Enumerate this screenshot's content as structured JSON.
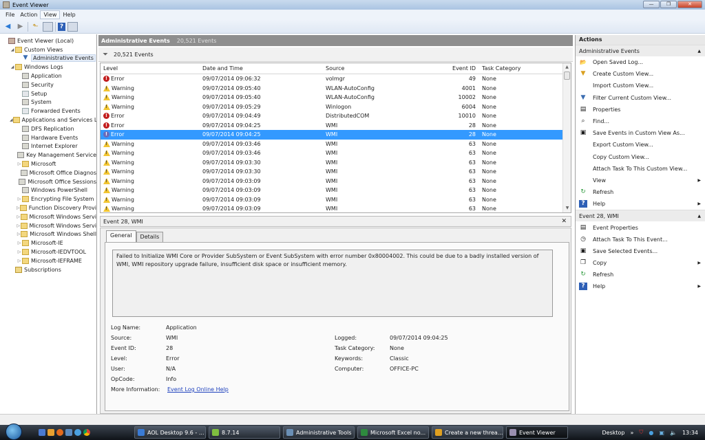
{
  "window": {
    "title": "Event Viewer",
    "controls": [
      "minimize",
      "maximize",
      "close"
    ]
  },
  "menu": [
    "File",
    "Action",
    "View",
    "Help"
  ],
  "menu_active": "View",
  "tree": [
    {
      "label": "Event Viewer (Local)",
      "level": 0,
      "icon": "root",
      "arrow": ""
    },
    {
      "label": "Custom Views",
      "level": 1,
      "icon": "folder",
      "arrow": "◢"
    },
    {
      "label": "Administrative Events",
      "level": 2,
      "icon": "filter",
      "arrow": "",
      "selected": true
    },
    {
      "label": "Windows Logs",
      "level": 1,
      "icon": "folder",
      "arrow": "◢"
    },
    {
      "label": "Application",
      "level": 2,
      "icon": "log",
      "arrow": ""
    },
    {
      "label": "Security",
      "level": 2,
      "icon": "log",
      "arrow": ""
    },
    {
      "label": "Setup",
      "level": 2,
      "icon": "logg",
      "arrow": ""
    },
    {
      "label": "System",
      "level": 2,
      "icon": "log",
      "arrow": ""
    },
    {
      "label": "Forwarded Events",
      "level": 2,
      "icon": "logg",
      "arrow": ""
    },
    {
      "label": "Applications and Services Lo",
      "level": 1,
      "icon": "folder",
      "arrow": "◢"
    },
    {
      "label": "DFS Replication",
      "level": 2,
      "icon": "log",
      "arrow": ""
    },
    {
      "label": "Hardware Events",
      "level": 2,
      "icon": "log",
      "arrow": ""
    },
    {
      "label": "Internet Explorer",
      "level": 2,
      "icon": "log",
      "arrow": ""
    },
    {
      "label": "Key Management Service",
      "level": 2,
      "icon": "log",
      "arrow": ""
    },
    {
      "label": "Microsoft",
      "level": 2,
      "icon": "folder",
      "arrow": "▷"
    },
    {
      "label": "Microsoft Office Diagnos",
      "level": 2,
      "icon": "log",
      "arrow": ""
    },
    {
      "label": "Microsoft Office Sessions",
      "level": 2,
      "icon": "log",
      "arrow": ""
    },
    {
      "label": "Windows PowerShell",
      "level": 2,
      "icon": "log",
      "arrow": ""
    },
    {
      "label": "Encrypting File System",
      "level": 2,
      "icon": "folder",
      "arrow": "▷"
    },
    {
      "label": "Function Discovery Provi",
      "level": 2,
      "icon": "folder",
      "arrow": "▷"
    },
    {
      "label": "Microsoft Windows Servi",
      "level": 2,
      "icon": "folder",
      "arrow": "▷"
    },
    {
      "label": "Microsoft Windows Servi",
      "level": 2,
      "icon": "folder",
      "arrow": "▷"
    },
    {
      "label": "Microsoft Windows Shell",
      "level": 2,
      "icon": "folder",
      "arrow": "▷"
    },
    {
      "label": "Microsoft-IE",
      "level": 2,
      "icon": "folder",
      "arrow": "▷"
    },
    {
      "label": "Microsoft-IEDVTOOL",
      "level": 2,
      "icon": "folder",
      "arrow": "▷"
    },
    {
      "label": "Microsoft-IEFRAME",
      "level": 2,
      "icon": "folder",
      "arrow": "▷"
    },
    {
      "label": "Subscriptions",
      "level": 1,
      "icon": "sub",
      "arrow": ""
    }
  ],
  "center": {
    "title": "Administrative Events",
    "count": "20,521 Events",
    "filter_count": "20,521 Events",
    "columns": [
      "Level",
      "Date and Time",
      "Source",
      "Event ID",
      "Task Category"
    ],
    "rows": [
      {
        "level": "Error",
        "date": "09/07/2014 09:06:32",
        "source": "volmgr",
        "id": "49",
        "task": "None"
      },
      {
        "level": "Warning",
        "date": "09/07/2014 09:05:40",
        "source": "WLAN-AutoConfig",
        "id": "4001",
        "task": "None"
      },
      {
        "level": "Warning",
        "date": "09/07/2014 09:05:40",
        "source": "WLAN-AutoConfig",
        "id": "10002",
        "task": "None"
      },
      {
        "level": "Warning",
        "date": "09/07/2014 09:05:29",
        "source": "Winlogon",
        "id": "6004",
        "task": "None"
      },
      {
        "level": "Error",
        "date": "09/07/2014 09:04:49",
        "source": "DistributedCOM",
        "id": "10010",
        "task": "None"
      },
      {
        "level": "Error",
        "date": "09/07/2014 09:04:25",
        "source": "WMI",
        "id": "28",
        "task": "None"
      },
      {
        "level": "Error",
        "date": "09/07/2014 09:04:25",
        "source": "WMI",
        "id": "28",
        "task": "None",
        "selected": true
      },
      {
        "level": "Warning",
        "date": "09/07/2014 09:03:46",
        "source": "WMI",
        "id": "63",
        "task": "None"
      },
      {
        "level": "Warning",
        "date": "09/07/2014 09:03:46",
        "source": "WMI",
        "id": "63",
        "task": "None"
      },
      {
        "level": "Warning",
        "date": "09/07/2014 09:03:30",
        "source": "WMI",
        "id": "63",
        "task": "None"
      },
      {
        "level": "Warning",
        "date": "09/07/2014 09:03:30",
        "source": "WMI",
        "id": "63",
        "task": "None"
      },
      {
        "level": "Warning",
        "date": "09/07/2014 09:03:09",
        "source": "WMI",
        "id": "63",
        "task": "None"
      },
      {
        "level": "Warning",
        "date": "09/07/2014 09:03:09",
        "source": "WMI",
        "id": "63",
        "task": "None"
      },
      {
        "level": "Warning",
        "date": "09/07/2014 09:03:09",
        "source": "WMI",
        "id": "63",
        "task": "None"
      },
      {
        "level": "Warning",
        "date": "09/07/2014 09:03:09",
        "source": "WMI",
        "id": "63",
        "task": "None"
      }
    ]
  },
  "detail": {
    "title": "Event 28, WMI",
    "tabs": [
      "General",
      "Details"
    ],
    "message": "Failed to Initialize WMI Core or Provider SubSystem or Event SubSystem with error number 0x80004002. This could be due to a badly installed version of WMI, WMI repository upgrade failure, insufficient disk space or insufficient memory.",
    "left": [
      {
        "k": "Log Name:",
        "v": "Application"
      },
      {
        "k": "Source:",
        "v": "WMI"
      },
      {
        "k": "Event ID:",
        "v": "28"
      },
      {
        "k": "Level:",
        "v": "Error"
      },
      {
        "k": "User:",
        "v": "N/A"
      },
      {
        "k": "OpCode:",
        "v": "Info"
      },
      {
        "k": "More Information:",
        "v": "Event Log Online Help"
      }
    ],
    "right": [
      {
        "k": "Logged:",
        "v": "09/07/2014 09:04:25"
      },
      {
        "k": "Task Category:",
        "v": "None"
      },
      {
        "k": "Keywords:",
        "v": "Classic"
      },
      {
        "k": "Computer:",
        "v": "OFFICE-PC"
      }
    ]
  },
  "actions": {
    "title": "Actions",
    "group1": "Administrative Events",
    "items1": [
      {
        "label": "Open Saved Log...",
        "icon": "folder-open-icon",
        "glyph": "📂",
        "sub": false
      },
      {
        "label": "Create Custom View...",
        "icon": "create-filter-icon",
        "glyph": "▼",
        "sub": false
      },
      {
        "label": "Import Custom View...",
        "icon": "",
        "glyph": "",
        "sub": false
      },
      {
        "label": "Filter Current Custom View...",
        "icon": "filter-icon",
        "glyph": "▼",
        "sub": false
      },
      {
        "label": "Properties",
        "icon": "properties-icon",
        "glyph": "▤",
        "sub": false
      },
      {
        "label": "Find...",
        "icon": "binoculars-icon",
        "glyph": "⌕",
        "sub": false
      },
      {
        "label": "Save Events in Custom View As...",
        "icon": "save-icon",
        "glyph": "▣",
        "sub": false
      },
      {
        "label": "Export Custom View...",
        "icon": "",
        "glyph": "",
        "sub": false
      },
      {
        "label": "Copy Custom View...",
        "icon": "",
        "glyph": "",
        "sub": false
      },
      {
        "label": "Attach Task To This Custom View...",
        "icon": "",
        "glyph": "",
        "sub": false
      },
      {
        "label": "View",
        "icon": "",
        "glyph": "",
        "sub": true
      },
      {
        "label": "Refresh",
        "icon": "refresh-icon",
        "glyph": "↻",
        "sub": false
      },
      {
        "label": "Help",
        "icon": "help-icon",
        "glyph": "?",
        "sub": true
      }
    ],
    "group2": "Event 28, WMI",
    "items2": [
      {
        "label": "Event Properties",
        "icon": "event-properties-icon",
        "glyph": "▤",
        "sub": false
      },
      {
        "label": "Attach Task To This Event...",
        "icon": "attach-task-icon",
        "glyph": "◷",
        "sub": false
      },
      {
        "label": "Save Selected Events...",
        "icon": "save-icon",
        "glyph": "▣",
        "sub": false
      },
      {
        "label": "Copy",
        "icon": "copy-icon",
        "glyph": "❐",
        "sub": true
      },
      {
        "label": "Refresh",
        "icon": "refresh-icon",
        "glyph": "↻",
        "sub": false
      },
      {
        "label": "Help",
        "icon": "help-icon",
        "glyph": "?",
        "sub": true
      }
    ]
  },
  "taskbar": {
    "buttons": [
      {
        "label": "AOL Desktop 9.6 - ...",
        "color": "#3a7bd5"
      },
      {
        "label": "8.7.14",
        "color": "#7fbf3f"
      },
      {
        "label": "Administrative Tools",
        "color": "#6a8fb5"
      },
      {
        "label": "Microsoft Excel no...",
        "color": "#2e8b3e"
      },
      {
        "label": "Create a new threa...",
        "color": "#e0a020"
      },
      {
        "label": "Event Viewer",
        "color": "#9a8fb0",
        "active": true
      }
    ],
    "desktop_label": "Desktop",
    "clock": "13:34"
  },
  "colors": {
    "selection": "#3399ff",
    "error": "#c21d1d",
    "warning": "#f2c530",
    "link": "#1c3fbc"
  }
}
